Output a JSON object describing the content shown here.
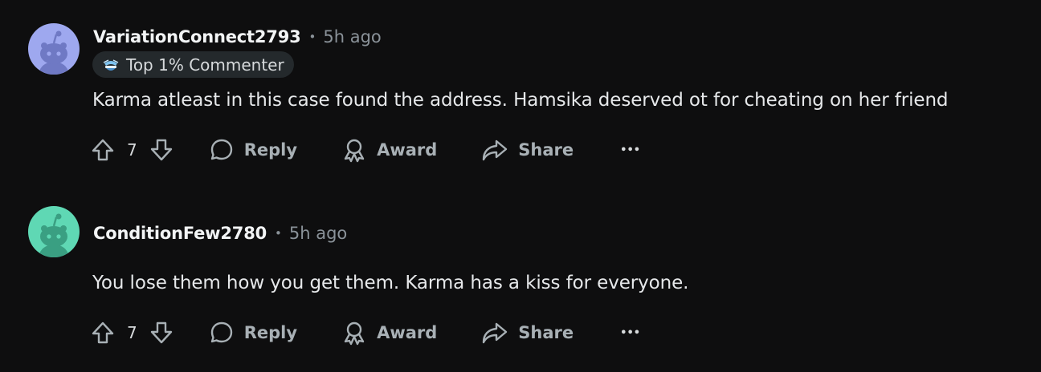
{
  "comments": [
    {
      "username": "VariationConnect2793",
      "separator": "•",
      "time": "5h ago",
      "avatar_color": "#9ea8ef",
      "badge": {
        "icon": "commenter-badge-icon",
        "label": "Top 1% Commenter"
      },
      "text": "Karma atleast in this case found the address. Hamsika deserved ot for cheating on her friend",
      "votes": "7",
      "reply_label": "Reply",
      "award_label": "Award",
      "share_label": "Share",
      "more_label": "•••"
    },
    {
      "username": "ConditionFew2780",
      "separator": "•",
      "time": "5h ago",
      "avatar_color": "#5fd8b4",
      "text": "You lose them how you get them. Karma has a kiss for everyone.",
      "votes": "7",
      "reply_label": "Reply",
      "award_label": "Award",
      "share_label": "Share",
      "more_label": "•••"
    }
  ]
}
